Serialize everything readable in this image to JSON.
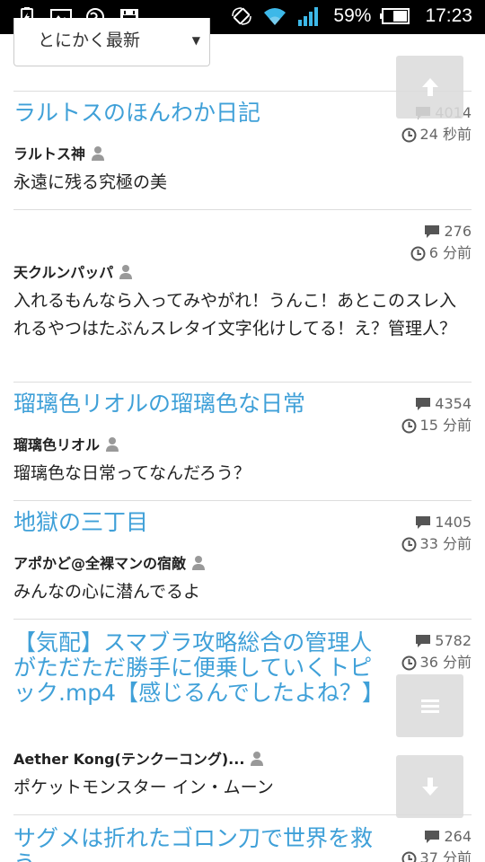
{
  "status_bar": {
    "battery_percent": "59%",
    "time": "17:23"
  },
  "sort": {
    "selected": "とにかく最新"
  },
  "threads": [
    {
      "title": "ラルトスのほんわか日記",
      "comments": "4014",
      "time": "24 秒前",
      "author": "ラルトス神",
      "body": "永遠に残る究極の美"
    },
    {
      "title": "",
      "comments": "276",
      "time": "6 分前",
      "author": "天クルンパッパ",
      "body": "入れるもんなら入ってみやがれ！うんこ！あとこのスレ入れるやつはたぶんスレタイ文字化けしてる！え？管理人？"
    },
    {
      "title": "瑠璃色リオルの瑠璃色な日常",
      "comments": "4354",
      "time": "15 分前",
      "author": "瑠璃色リオル",
      "body": "瑠璃色な日常ってなんだろう？"
    },
    {
      "title": "地獄の三丁目",
      "comments": "1405",
      "time": "33 分前",
      "author": "アポかど@全裸マンの宿敵",
      "body": "みんなの心に潜んでるよ"
    },
    {
      "title": "【気配】スマブラ攻略総合の管理人がただただ勝手に便乗していくトピック.mp4【感じるんでしたよね？】",
      "comments": "5782",
      "time": "36 分前",
      "author": "Aether Kong(テンクーコング)...",
      "body": "ポケットモンスター イン・ムーン"
    },
    {
      "title": "サグメは折れたゴロン刀で世界を救う",
      "comments": "264",
      "time": "37 分前",
      "author": "",
      "body": ""
    }
  ],
  "colors": {
    "title": "#3fa0d8",
    "divider": "#dddddd",
    "fab": "#dcdcdc"
  }
}
